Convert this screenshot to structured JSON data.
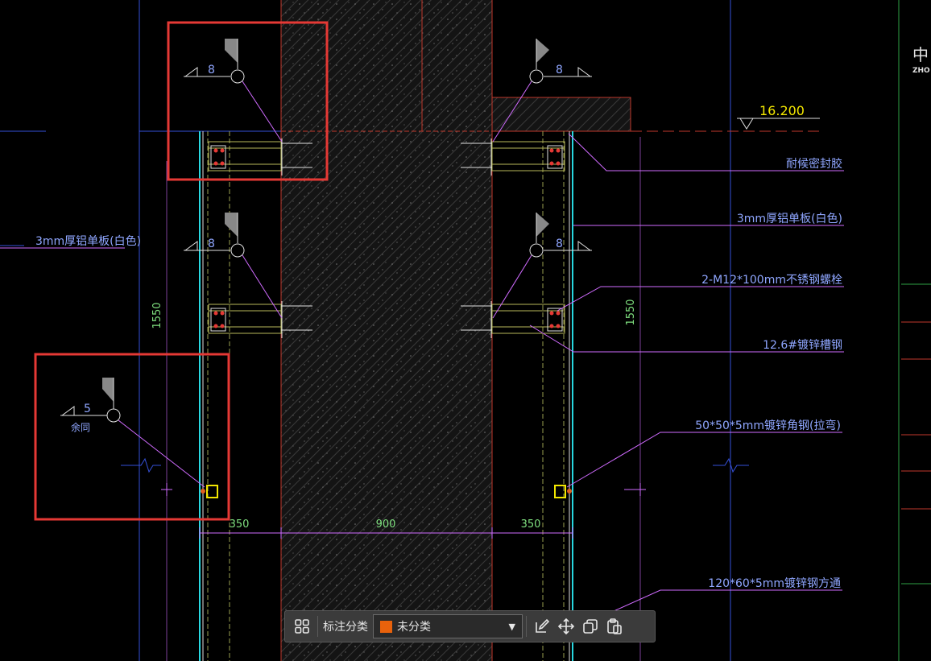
{
  "colors": {
    "background": "#000000",
    "concrete_border": "#c0392b",
    "highlight_box": "#e53935",
    "dimension": "#7fe07f",
    "annotation": "#8fa6ff",
    "leader": "#d06bff",
    "level": "#f2e600",
    "category_swatch": "#e8620c"
  },
  "drawing": {
    "level_value": "16.200",
    "dims": {
      "vertical_left": "1550",
      "vertical_right": "1550",
      "width_left": "350",
      "width_center": "900",
      "width_right": "350"
    },
    "weld_symbols": {
      "top_left": "8",
      "top_right": "8",
      "mid_left": "8",
      "mid_right": "8",
      "bottom_left": "5",
      "bottom_left_note": "余同"
    },
    "labels": {
      "sealant": "耐候密封胶",
      "alum_panel_right": "3mm厚铝单板(白色)",
      "alum_panel_left": "3mm厚铝单板(白色)",
      "bolts": "2-M12*100mm不锈钢螺栓",
      "channel": "12.6#镀锌槽钢",
      "angle": "50*50*5mm镀锌角钢(拉弯)",
      "tube": "120*60*5mm镀锌钢方通"
    },
    "title_block": {
      "logo_char": "中",
      "logo_text": "ZHO"
    }
  },
  "toolbar": {
    "label": "标注分类",
    "category_value": "未分类",
    "icons": [
      "grid-icon",
      "edit-icon",
      "move-icon",
      "copy-icon",
      "paste-icon"
    ]
  }
}
